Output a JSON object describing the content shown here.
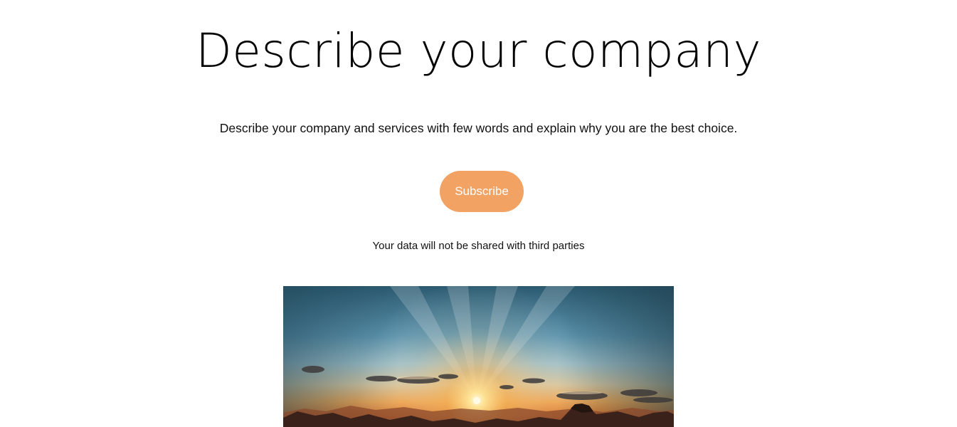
{
  "hero": {
    "heading": "Describe your company",
    "description": "Describe your company and services with few words and explain why you are the best choice.",
    "subscribe_label": "Subscribe",
    "privacy_note": "Your data will not be shared with third parties"
  },
  "colors": {
    "accent": "#f2a263",
    "text": "#000000",
    "background": "#ffffff"
  },
  "image": {
    "subject": "sunset-over-rocky-landscape"
  }
}
